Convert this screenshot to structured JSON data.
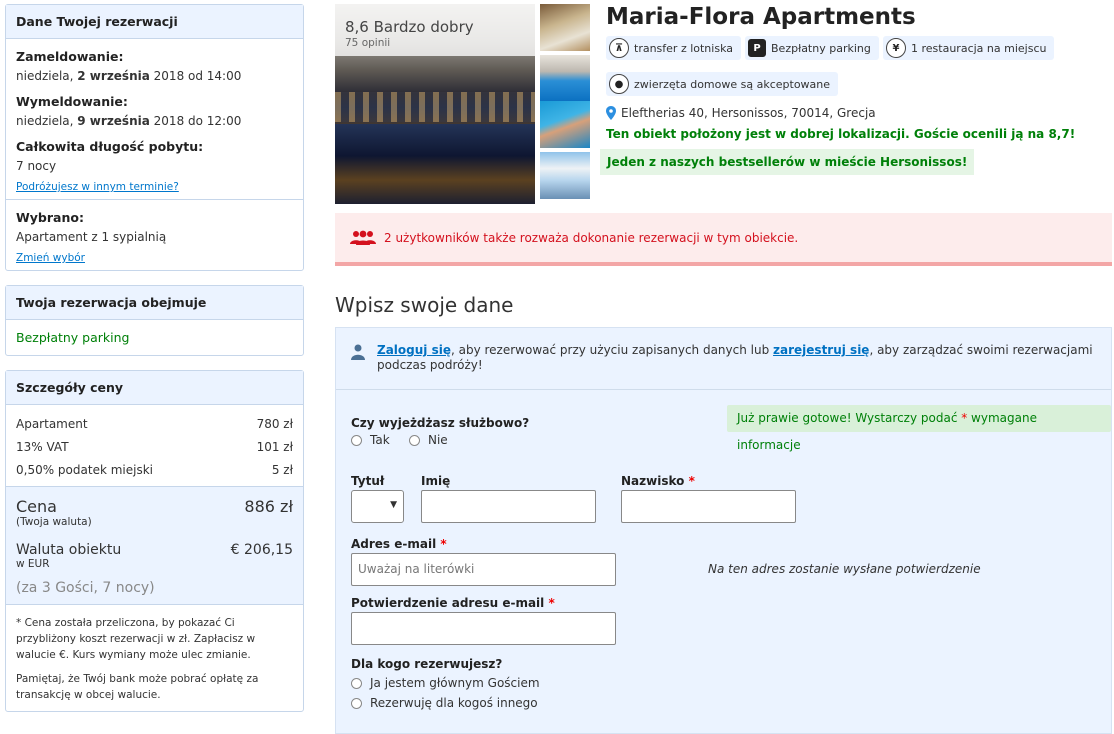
{
  "sidebar": {
    "reservation": {
      "header": "Dane Twojej rezerwacji",
      "checkin_label": "Zameldowanie:",
      "checkin_day": "niedziela, ",
      "checkin_date": "2 września",
      "checkin_rest": " 2018 od 14:00",
      "checkout_label": "Wymeldowanie:",
      "checkout_day": "niedziela, ",
      "checkout_date": "9 września",
      "checkout_rest": " 2018 do 12:00",
      "length_label": "Całkowita długość pobytu:",
      "length_value": "7 nocy",
      "other_dates_link": "Podróżujesz w innym terminie?",
      "selected_label": "Wybrano:",
      "selected_value": "Apartament z 1 sypialnią",
      "change_link": "Zmień wybór"
    },
    "includes": {
      "header": "Twoja rezerwacja obejmuje",
      "item": "Bezpłatny parking"
    },
    "price": {
      "header": "Szczegóły ceny",
      "rows": [
        {
          "label": "Apartament",
          "value": "780 zł"
        },
        {
          "label": "13% VAT",
          "value": "101 zł"
        },
        {
          "label": "0,50% podatek miejski",
          "value": "5 zł"
        }
      ],
      "total_label": "Cena",
      "total_value": "886 zł",
      "total_sub": "(Twoja waluta)",
      "local_label": "Waluta obiektu",
      "local_value": "€ 206,15",
      "local_sub": "w EUR",
      "guests": "(za 3 Gości, 7 nocy)",
      "note1": "* Cena została przeliczona, by pokazać Ci przybliżony koszt rezerwacji w zł. Zapłacisz w walucie €. Kurs wymiany może ulec zmianie.",
      "note2": "Pamiętaj, że Twój bank może pobrać opłatę za transakcję w obcej walucie."
    }
  },
  "hotel": {
    "rating": "8,6 Bardzo dobry",
    "reviews": "75 opinii",
    "name": "Maria-Flora Apartments",
    "facilities": [
      {
        "label": "transfer z lotniska",
        "icon": "shuttle-icon"
      },
      {
        "label": "Bezpłatny parking",
        "icon": "parking-icon"
      },
      {
        "label": "1 restauracja na miejscu",
        "icon": "cutlery-icon"
      },
      {
        "label": "zwierzęta domowe są akceptowane",
        "icon": "paw-icon"
      }
    ],
    "address": "Eleftherias 40, Hersonissos, 70014, Grecja",
    "location_note": "Ten obiekt położony jest w dobrej lokalizacji. Goście ocenili ją na 8,7!",
    "bestseller": "Jeden z naszych bestsellerów w mieście Hersonissos!"
  },
  "alert": {
    "text": "2 użytkowników także rozważa dokonanie rezerwacji w tym obiekcie.",
    "color": "#d4111e"
  },
  "form": {
    "title": "Wpisz swoje dane",
    "login_link": "Zaloguj się",
    "login_mid": ", aby rezerwować przy użyciu zapisanych danych lub ",
    "register_link": "zarejestruj się",
    "login_end": ", aby zarządzać swoimi rezerwacjami podczas podróży!",
    "ready_text": "Już prawie gotowe! Wystarczy podać ",
    "ready_star": "*",
    "ready_end": " wymagane informacje",
    "business_label": "Czy wyjeżdżasz służbowo?",
    "yes": "Tak",
    "no": "Nie",
    "title_label": "Tytuł",
    "firstname_label": "Imię",
    "lastname_label": "Nazwisko",
    "req": "*",
    "email_label": "Adres e-mail",
    "email_placeholder": "Uważaj na literówki",
    "email_hint": "Na ten adres zostanie wysłane potwierdzenie",
    "confirm_label": "Potwierdzenie adresu e-mail",
    "for_whom_label": "Dla kogo rezerwujesz?",
    "for_me": "Ja jestem głównym Gościem",
    "for_other": "Rezerwuję dla kogoś innego"
  },
  "colors": {
    "accent_blue": "#0071c2",
    "green": "#008009",
    "panel": "#ebf3ff"
  }
}
